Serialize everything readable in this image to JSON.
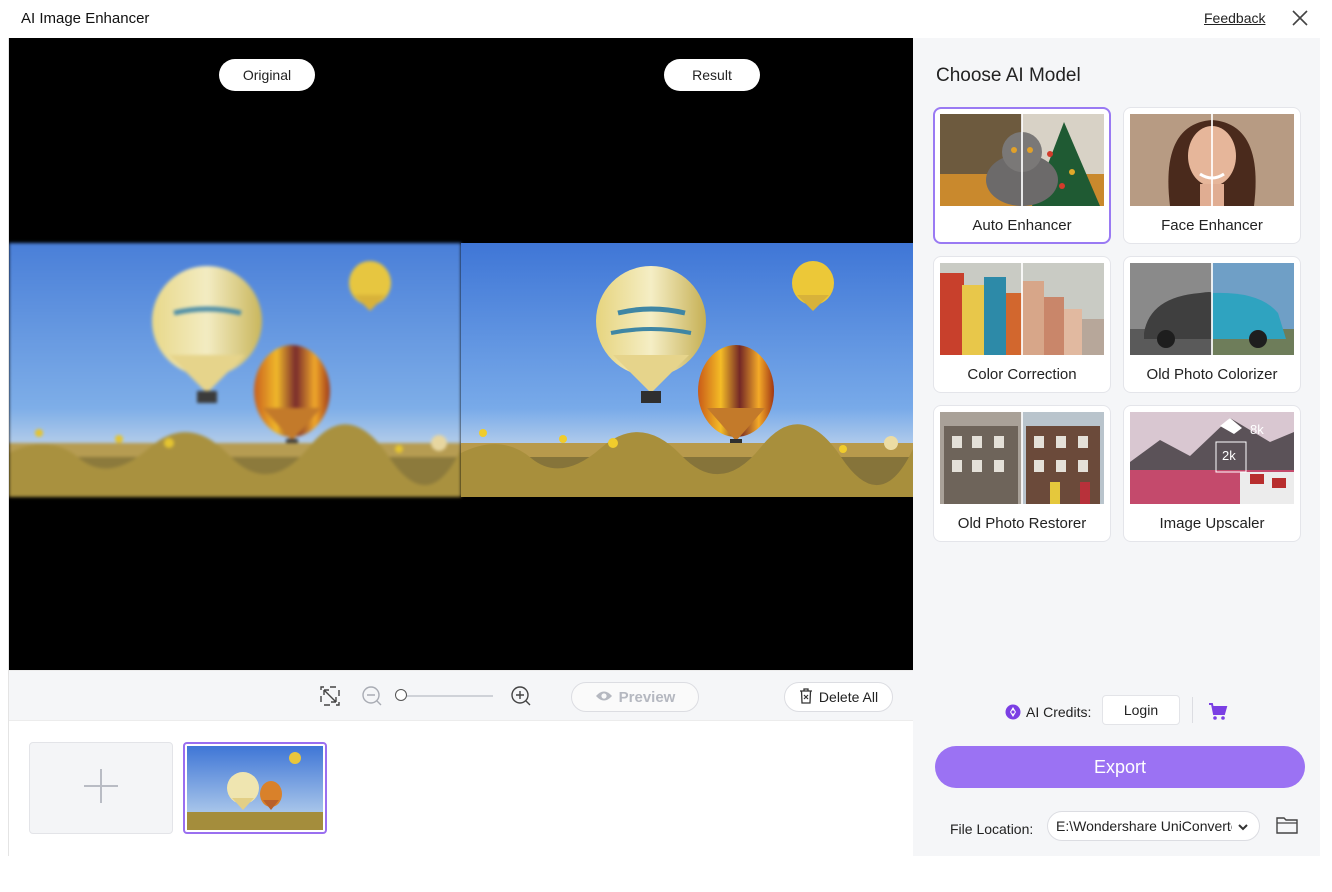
{
  "window": {
    "title": "AI Image Enhancer",
    "feedback_label": "Feedback"
  },
  "preview": {
    "original_label": "Original",
    "result_label": "Result"
  },
  "toolbar": {
    "preview_label": "Preview",
    "delete_all_label": "Delete All"
  },
  "panel": {
    "title": "Choose AI Model",
    "models": [
      {
        "label": "Auto Enhancer",
        "selected": true
      },
      {
        "label": "Face Enhancer",
        "selected": false
      },
      {
        "label": "Color Correction",
        "selected": false
      },
      {
        "label": "Old Photo Colorizer",
        "selected": false
      },
      {
        "label": "Old Photo Restorer",
        "selected": false
      },
      {
        "label": "Image Upscaler",
        "selected": false
      }
    ],
    "upscaler_badges": [
      "8k",
      "2k"
    ]
  },
  "footer": {
    "credits_label": "AI Credits:",
    "login_label": "Login",
    "export_label": "Export",
    "file_location_label": "File Location:",
    "file_location_value": "E:\\Wondershare UniConverter"
  },
  "colors": {
    "accent": "#9b72f3",
    "preview_bg": "#000000",
    "panel_bg": "#f5f6f8"
  }
}
